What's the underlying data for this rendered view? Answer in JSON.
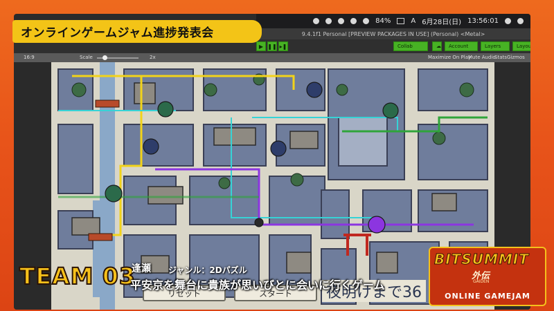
{
  "event_title": "オンラインゲームジャム進捗発表会",
  "mac_menubar": {
    "battery": "84%",
    "input_method": "A",
    "date": "6月28日(日)",
    "time": "13:56:01"
  },
  "unity_title": "9.4.1f1 Personal [PREVIEW PACKAGES IN USE] (Personal) <Metal>",
  "toolbar": {
    "collab": "Collab",
    "account": "Account",
    "layers": "Layers",
    "layout": "Layout"
  },
  "game_view": {
    "aspect": "16:9",
    "scale_label": "Scale",
    "scale_value": "2x",
    "maximize": "Maximize On Play",
    "mute": "Mute Audio",
    "stats": "Stats",
    "gizmos": "Gizmos"
  },
  "game_ui": {
    "reset": "リセット",
    "start": "スタート",
    "timer": "夜明けまで36"
  },
  "team": {
    "label": "TEAM 03",
    "name": "逢瀬",
    "genre": "ジャンル：2Dパズル",
    "description": "平安京を舞台に貴族が思いびとに会いに行くゲーム"
  },
  "logo": {
    "main": "BITSUMMIT",
    "sub": "外伝",
    "small": "GAIDEN",
    "footer": "ONLINE GAMEJAM"
  },
  "colors": {
    "accent_orange": "#e8541a",
    "banner_yellow": "#f3c417",
    "unity_green": "#47b224"
  }
}
